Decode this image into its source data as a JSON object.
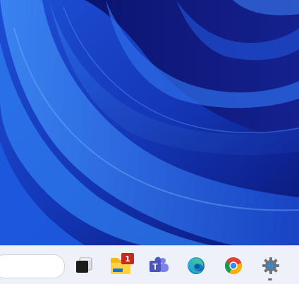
{
  "desktop": {
    "wallpaper": "windows-11-bloom-blue"
  },
  "taskbar": {
    "apps": [
      {
        "name": "task-view",
        "icon": "task-view-icon"
      },
      {
        "name": "file-explorer",
        "icon": "folder-icon",
        "badge": "1"
      },
      {
        "name": "teams",
        "icon": "teams-icon"
      },
      {
        "name": "edge",
        "icon": "edge-icon"
      },
      {
        "name": "chrome",
        "icon": "chrome-icon"
      },
      {
        "name": "settings",
        "icon": "gear-icon",
        "active": true
      }
    ],
    "colors": {
      "background": "#eef2f8",
      "badge": "#c42b1c"
    }
  }
}
